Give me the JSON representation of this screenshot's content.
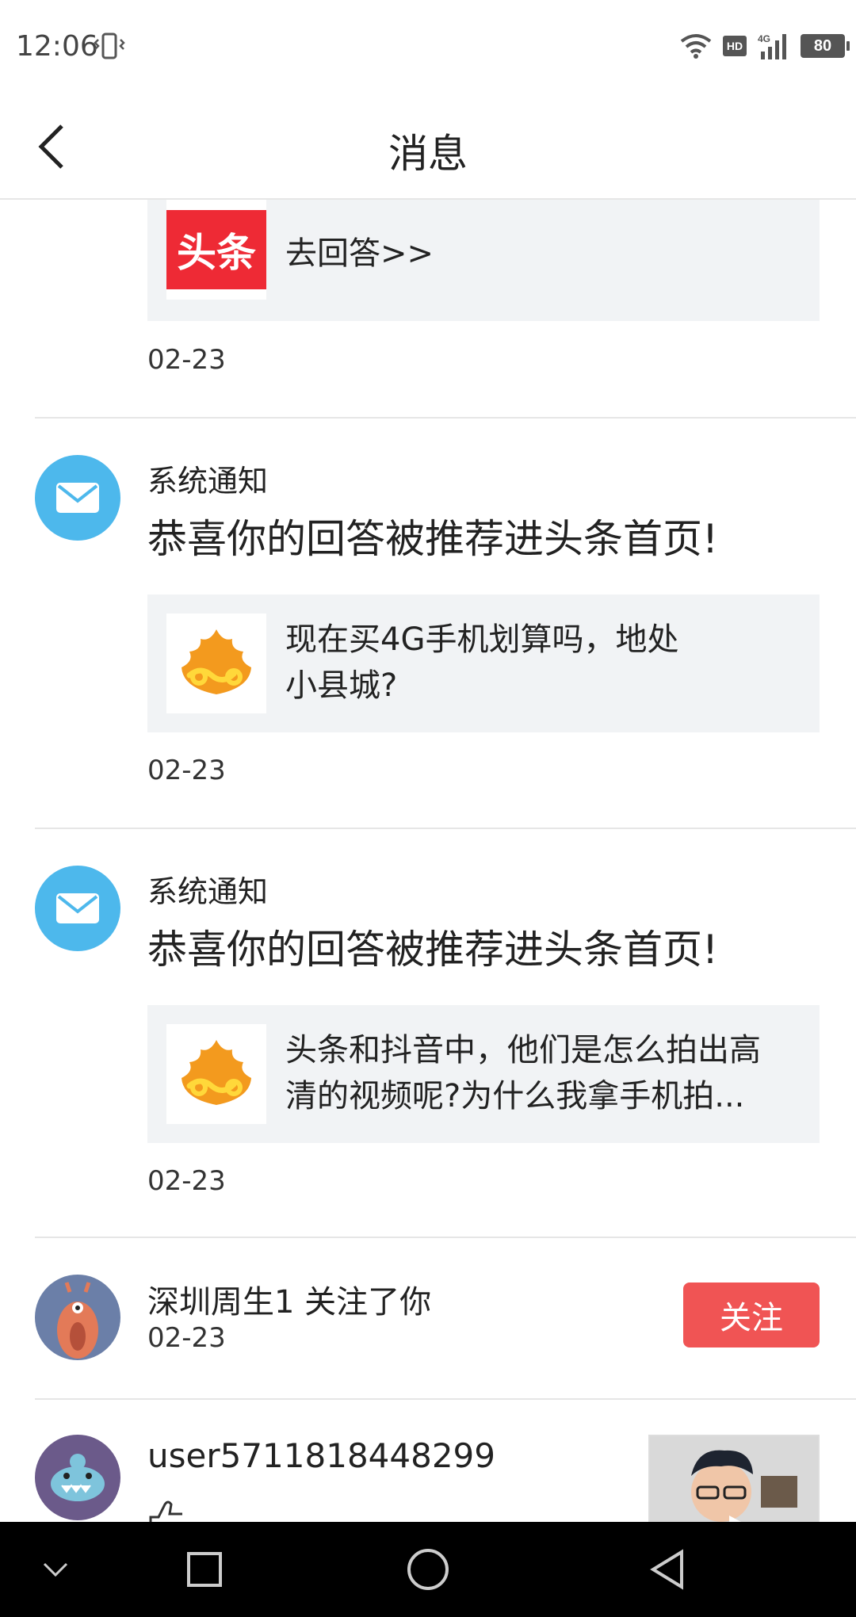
{
  "status_bar": {
    "time": "12:06",
    "battery": "80",
    "hd": "HD",
    "network": "4G"
  },
  "header": {
    "title": "消息"
  },
  "items": [
    {
      "box_text": "去回答>>",
      "thumb_label": "头条",
      "date": "02-23"
    },
    {
      "sender": "系统通知",
      "headline": "恭喜你的回答被推荐进头条首页!",
      "box_line1": "现在买4G手机划算吗，地处",
      "box_line2": "小县城?",
      "date": "02-23"
    },
    {
      "sender": "系统通知",
      "headline": "恭喜你的回答被推荐进头条首页!",
      "box_line1": "头条和抖音中，他们是怎么拍出高",
      "box_line2": "清的视频呢?为什么我拿手机拍...",
      "date": "02-23"
    },
    {
      "follow_text": "深圳周生1 关注了你",
      "date": "02-23",
      "button_label": "关注"
    },
    {
      "username": "user5711818448299"
    }
  ],
  "colors": {
    "accent_red": "#f05454",
    "mail_blue": "#4db8ec",
    "toutiao_red": "#ee2a35"
  }
}
